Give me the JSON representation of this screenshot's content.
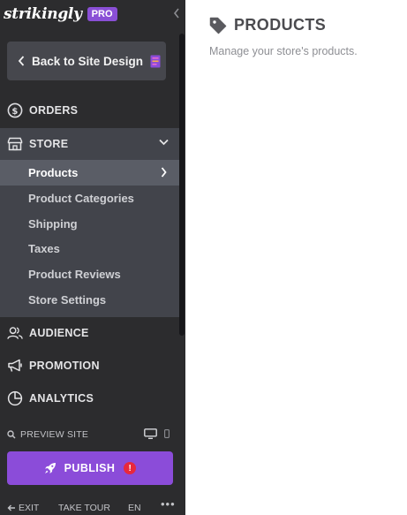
{
  "brand": {
    "logo": "strikingly",
    "badge": "PRO"
  },
  "sidebar": {
    "back_label": "Back to Site Design",
    "nav": {
      "orders": "ORDERS",
      "store": "STORE",
      "audience": "AUDIENCE",
      "promotion": "PROMOTION",
      "analytics": "ANALYTICS"
    },
    "store_items": [
      {
        "label": "Products",
        "active": true
      },
      {
        "label": "Product Categories"
      },
      {
        "label": "Shipping"
      },
      {
        "label": "Taxes"
      },
      {
        "label": "Product Reviews"
      },
      {
        "label": "Store Settings"
      }
    ],
    "preview_label": "PREVIEW SITE",
    "publish_label": "PUBLISH",
    "publish_alert": "!",
    "footer": {
      "exit": "EXIT",
      "tour": "TAKE TOUR",
      "lang": "EN",
      "more": "•••"
    }
  },
  "main": {
    "title": "PRODUCTS",
    "subtitle": "Manage your store's products."
  },
  "colors": {
    "sidebar_bg": "#2c2c2e",
    "store_group_bg": "#42444b",
    "active_item_bg": "#5a5d66",
    "publish_bg": "#8b4cd9",
    "alert": "#e8283c"
  },
  "icons": {
    "collapse": "chevron-left-icon",
    "orders": "dollar-circle-icon",
    "store": "storefront-icon",
    "audience": "users-icon",
    "promotion": "megaphone-icon",
    "analytics": "pie-chart-icon",
    "preview": "search-icon",
    "desktop": "monitor-icon",
    "mobile": "phone-icon",
    "publish": "rocket-icon",
    "title": "tag-icon"
  }
}
